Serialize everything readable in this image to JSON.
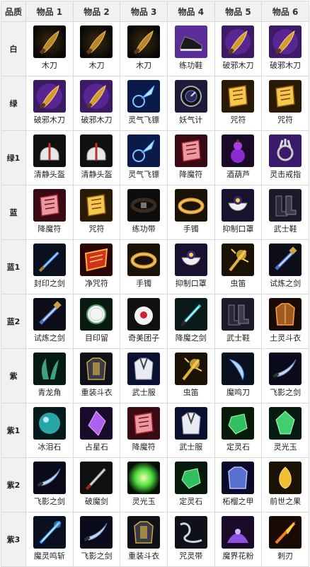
{
  "header": {
    "quality": "品质",
    "columns": [
      "物品 1",
      "物品 2",
      "物品 3",
      "物品 4",
      "物品 5",
      "物品 6"
    ]
  },
  "rows": [
    {
      "quality": "白",
      "items": [
        {
          "name": "木刀",
          "icon": "wooden-blade-icon"
        },
        {
          "name": "木刀",
          "icon": "wooden-blade-icon"
        },
        {
          "name": "木刀",
          "icon": "wooden-blade-icon"
        },
        {
          "name": "练功鞋",
          "icon": "training-shoes-icon"
        },
        {
          "name": "破邪木刀",
          "icon": "evil-breaking-blade-icon"
        },
        {
          "name": "破邪木刀",
          "icon": "evil-breaking-blade-icon"
        }
      ]
    },
    {
      "quality": "绿",
      "items": [
        {
          "name": "破邪木刀",
          "icon": "evil-breaking-blade-icon"
        },
        {
          "name": "破邪木刀",
          "icon": "evil-breaking-blade-icon"
        },
        {
          "name": "灵气飞镖",
          "icon": "spirit-dart-icon"
        },
        {
          "name": "妖气计",
          "icon": "demon-meter-icon"
        },
        {
          "name": "咒符",
          "icon": "talisman-icon"
        },
        {
          "name": "咒符",
          "icon": "talisman-icon"
        }
      ]
    },
    {
      "quality": "绿1",
      "items": [
        {
          "name": "清静头盔",
          "icon": "helmet-icon"
        },
        {
          "name": "清静头盔",
          "icon": "helmet-icon"
        },
        {
          "name": "灵气飞镖",
          "icon": "spirit-dart-icon"
        },
        {
          "name": "降魔符",
          "icon": "demon-talisman-icon"
        },
        {
          "name": "酒葫芦",
          "icon": "wine-gourd-icon"
        },
        {
          "name": "灵击戒指",
          "icon": "claw-ring-icon"
        }
      ]
    },
    {
      "quality": "蓝",
      "items": [
        {
          "name": "降魔符",
          "icon": "demon-talisman-icon"
        },
        {
          "name": "咒符",
          "icon": "talisman-icon"
        },
        {
          "name": "练功带",
          "icon": "belt-icon"
        },
        {
          "name": "手镯",
          "icon": "bracelet-icon"
        },
        {
          "name": "抑制口罩",
          "icon": "mask-icon"
        },
        {
          "name": "武士鞋",
          "icon": "boots-icon"
        }
      ]
    },
    {
      "quality": "蓝1",
      "items": [
        {
          "name": "封印之剑",
          "icon": "seal-sword-icon"
        },
        {
          "name": "净咒符",
          "icon": "red-talisman-icon"
        },
        {
          "name": "手镯",
          "icon": "bracelet-icon"
        },
        {
          "name": "抑制口罩",
          "icon": "mask-icon"
        },
        {
          "name": "虫笛",
          "icon": "insect-flute-icon"
        },
        {
          "name": "试炼之剑",
          "icon": "trial-sword-icon"
        }
      ]
    },
    {
      "quality": "蓝2",
      "items": [
        {
          "name": "试炼之剑",
          "icon": "trial-sword-icon"
        },
        {
          "name": "目印留",
          "icon": "white-disc-icon"
        },
        {
          "name": "奇美团子",
          "icon": "dumpling-icon"
        },
        {
          "name": "降魔之剑",
          "icon": "demon-sword-icon"
        },
        {
          "name": "武士鞋",
          "icon": "boots-icon"
        },
        {
          "name": "土灵斗衣",
          "icon": "earth-armor-icon"
        }
      ]
    },
    {
      "quality": "紫",
      "items": [
        {
          "name": "青龙角",
          "icon": "dragon-horn-icon"
        },
        {
          "name": "重装斗衣",
          "icon": "heavy-armor-icon"
        },
        {
          "name": "武士服",
          "icon": "samurai-robe-icon"
        },
        {
          "name": "虫笛",
          "icon": "insect-flute-icon"
        },
        {
          "name": "魔鸣刀",
          "icon": "crescent-blade-icon"
        },
        {
          "name": "飞影之剑",
          "icon": "shadow-sword-icon"
        }
      ]
    },
    {
      "quality": "紫1",
      "items": [
        {
          "name": "冰泪石",
          "icon": "ice-orb-icon"
        },
        {
          "name": "占星石",
          "icon": "purple-crystal-icon"
        },
        {
          "name": "降魔符",
          "icon": "demon-talisman-icon"
        },
        {
          "name": "武士服",
          "icon": "samurai-robe-icon"
        },
        {
          "name": "定灵石",
          "icon": "green-gem-icon"
        },
        {
          "name": "灵光玉",
          "icon": "green-jade-icon"
        }
      ]
    },
    {
      "quality": "紫2",
      "items": [
        {
          "name": "飞影之剑",
          "icon": "shadow-sword-icon"
        },
        {
          "name": "破魔剑",
          "icon": "demon-break-sword-icon"
        },
        {
          "name": "灵光玉",
          "icon": "glowing-orb-icon"
        },
        {
          "name": "定灵石",
          "icon": "green-gem-icon"
        },
        {
          "name": "柘榴之甲",
          "icon": "blue-armor-icon"
        },
        {
          "name": "前世之果",
          "icon": "golden-fruit-icon"
        }
      ]
    },
    {
      "quality": "紫3",
      "items": [
        {
          "name": "魔灵鸣斩",
          "icon": "spirit-sword-icon"
        },
        {
          "name": "飞影之剑",
          "icon": "shadow-sword-icon"
        },
        {
          "name": "重装斗衣",
          "icon": "heavy-armor-icon"
        },
        {
          "name": "咒灵带",
          "icon": "cursed-ribbon-icon"
        },
        {
          "name": "魔界花粉",
          "icon": "pollen-icon"
        },
        {
          "name": "刺刃",
          "icon": "flame-blade-icon"
        }
      ]
    }
  ]
}
